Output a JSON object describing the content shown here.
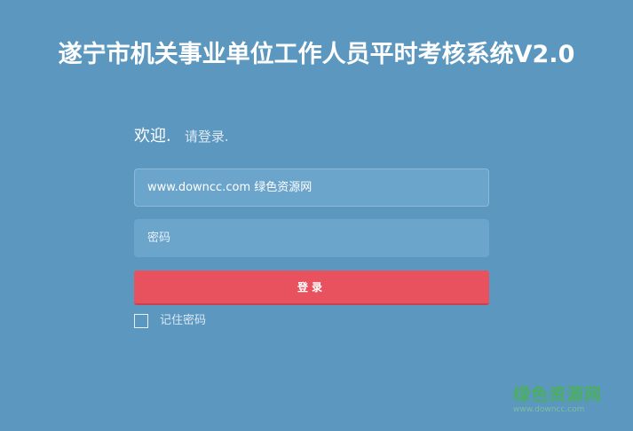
{
  "header": {
    "title": "遂宁市机关事业单位工作人员平时考核系统V2.0"
  },
  "login": {
    "welcome_main": "欢迎.",
    "welcome_sub": "请登录.",
    "username_value": "www.downcc.com 绿色资源网",
    "password_placeholder": "密码",
    "submit_label": "登录",
    "remember_label": "记住密码",
    "remember_checked": false
  },
  "watermark": {
    "title": "绿色资源网",
    "url": "www.downcc.com"
  },
  "colors": {
    "background": "#5b97bf",
    "field": "#6ba5cb",
    "button": "#e8525e",
    "watermark": "#4ab34f"
  }
}
